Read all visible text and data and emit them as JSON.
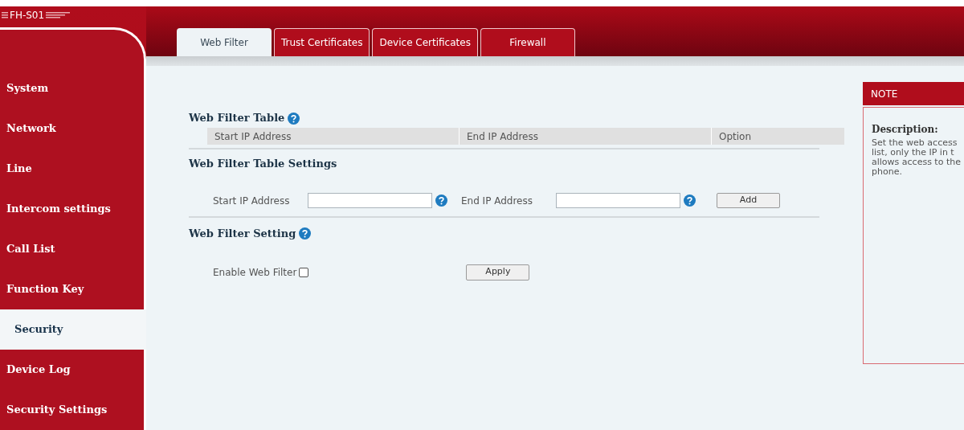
{
  "header": {
    "logo": "FH-S01"
  },
  "tabs": [
    {
      "label": "Web Filter",
      "selected": true
    },
    {
      "label": "Trust Certificates",
      "selected": false
    },
    {
      "label": "Device Certificates",
      "selected": false
    },
    {
      "label": "Firewall",
      "selected": false
    }
  ],
  "sidebar": {
    "items": [
      {
        "label": "System",
        "selected": false
      },
      {
        "label": "Network",
        "selected": false
      },
      {
        "label": "Line",
        "selected": false
      },
      {
        "label": "Intercom settings",
        "selected": false
      },
      {
        "label": "Call List",
        "selected": false
      },
      {
        "label": "Function Key",
        "selected": false
      },
      {
        "label": "Security",
        "selected": true
      },
      {
        "label": "Device Log",
        "selected": false
      },
      {
        "label": "Security Settings",
        "selected": false
      }
    ]
  },
  "web_filter_table": {
    "title": "Web Filter Table",
    "columns": [
      "Start IP Address",
      "End IP Address",
      "Option"
    ]
  },
  "table_settings": {
    "title": "Web Filter Table Settings",
    "start_label": "Start IP Address",
    "end_label": "End IP Address",
    "add_button": "Add"
  },
  "filter_setting": {
    "title": "Web Filter Setting",
    "enable_label": "Enable Web Filter",
    "enabled": false,
    "apply_button": "Apply"
  },
  "note": {
    "title": "NOTE",
    "heading": "Description:",
    "lines": [
      "Set the web access",
      "list, only the IP in t",
      "allows access to the",
      "phone."
    ]
  }
}
